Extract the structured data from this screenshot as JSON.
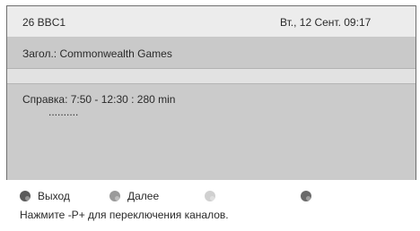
{
  "header": {
    "channel": "26  BBC1",
    "datetime": "Вт., 12 Сент.  09:17"
  },
  "program": {
    "title": "Загол.: Commonwealth Games"
  },
  "info": {
    "line1": "Справка: 7:50 - 12:30 : 280 min",
    "line2": ".........."
  },
  "footer": {
    "buttons": [
      {
        "label": "Выход",
        "color": "#5b5b5b",
        "icon": "red-button-icon"
      },
      {
        "label": "Далее",
        "color": "#9a9a9a",
        "icon": "green-button-icon"
      },
      {
        "label": "",
        "color": "#d0d0d0",
        "icon": "yellow-button-icon"
      },
      {
        "label": "",
        "color": "#6a6a6a",
        "icon": "blue-button-icon"
      }
    ],
    "hint": "Нажмите -P+ для переключения каналов."
  }
}
